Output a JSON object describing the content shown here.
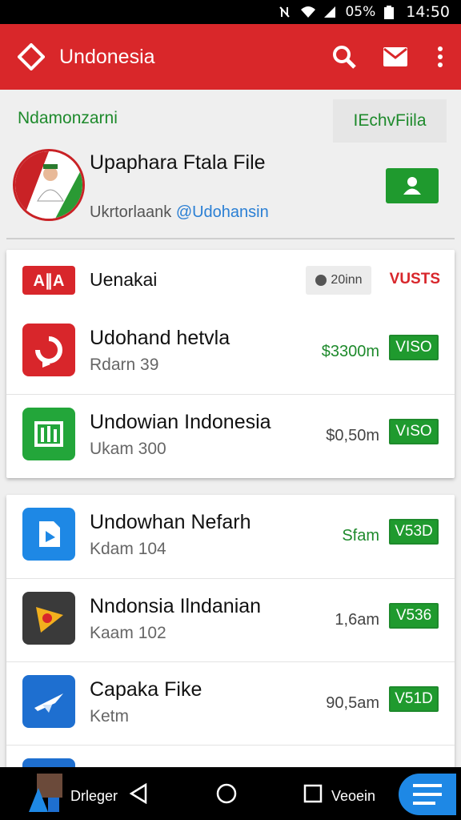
{
  "status": {
    "battery": "05%",
    "time": "14:50"
  },
  "appbar": {
    "title": "Undonesia"
  },
  "subbar": {
    "left": "Ndamonzarni",
    "right": "IEchvFiila"
  },
  "profile": {
    "name": "Upaphara Ftala File",
    "handle_prefix": "Ukrtorlaank ",
    "handle_at": "@Udohansin"
  },
  "card1": {
    "header": {
      "badge": "A∥A",
      "title": "Uenakai",
      "chip": "20inn",
      "visits": "VUSTS"
    },
    "rows": [
      {
        "title": "Udohand hetvla",
        "sub": "Rdarn 39",
        "price": "$3300m",
        "tag": "VISO",
        "icon": "refresh-icon",
        "color": "#d8262b"
      },
      {
        "title": "Undowian Indonesia",
        "sub": "Ukam 300",
        "price": "$0,50m",
        "tag": "VıSO",
        "icon": "chart-icon",
        "color": "#23a63a"
      }
    ]
  },
  "card2": {
    "rows": [
      {
        "title": "Undowhan Nefarh",
        "sub": "Kdam 104",
        "price": "Sfam",
        "tag": "V53D",
        "icon": "document-icon",
        "color": "#1e88e5"
      },
      {
        "title": "Nndonsia Ilndanian",
        "sub": "Kaam 102",
        "price": "1,6am",
        "tag": "V536",
        "icon": "play-icon",
        "color": "#3a3a3a"
      },
      {
        "title": "Capaka Fike",
        "sub": "Ketm",
        "price": "90,5am",
        "tag": "V51D",
        "icon": "plane-icon",
        "color": "#1e6fd0"
      }
    ]
  },
  "navbar": {
    "left_text": "Drleger",
    "right_text": "Veoein"
  }
}
